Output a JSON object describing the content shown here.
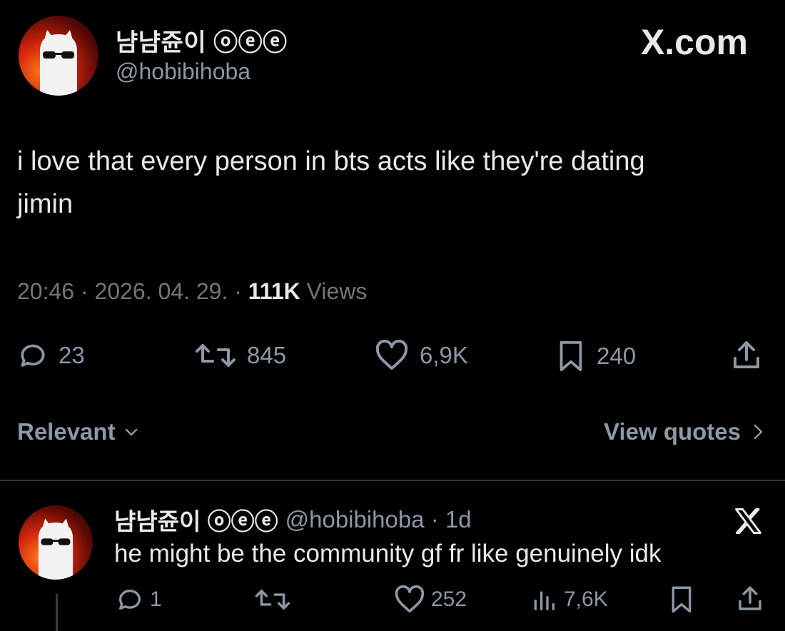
{
  "tweet": {
    "author_name": "냠냠쥰이 ⓞⓔⓔ",
    "author_handle": "@hobibihoba",
    "site_label": "X.com",
    "text_line1": "i love that every person in bts acts like they're dating",
    "text_line2": "jimin",
    "time": "20:46 · 2026. 04. 29. ·",
    "views_count": "111K",
    "views_label": "Views",
    "actions": {
      "replies": "23",
      "reposts": "845",
      "likes": "6,9K",
      "bookmarks": "240"
    }
  },
  "sort": {
    "label": "Relevant",
    "view_quotes": "View quotes"
  },
  "reply": {
    "author_name": "냠냠쥰이 ⓞⓔⓔ",
    "author_handle": "@hobibihoba · 1d",
    "text": "he might be the community gf fr like genuinely idk",
    "actions": {
      "replies": "1",
      "likes": "252",
      "views": "7,6K"
    }
  },
  "icons": [
    "ghost-avatar",
    "comment-icon",
    "repost-icon",
    "heart-icon",
    "bookmark-icon",
    "share-icon",
    "chevron-down-icon",
    "chevron-right-icon",
    "x-logo-icon",
    "views-bar-icon"
  ]
}
